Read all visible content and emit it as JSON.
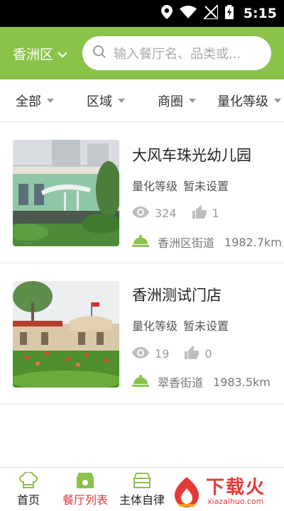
{
  "status_bar": {
    "time": "5:15"
  },
  "header": {
    "region": "香洲区",
    "search_placeholder": "输入餐厅名、品类或..."
  },
  "filters": [
    {
      "label": "全部"
    },
    {
      "label": "区域"
    },
    {
      "label": "商圈"
    },
    {
      "label": "量化等级"
    }
  ],
  "restaurants": [
    {
      "name": "大风车珠光幼儿园",
      "grade_label": "量化等级",
      "grade_value": "暂未设置",
      "views": "324",
      "likes": "1",
      "street": "香洲区街道",
      "distance": "1982.7km"
    },
    {
      "name": "香洲测试门店",
      "grade_label": "量化等级",
      "grade_value": "暂未设置",
      "views": "19",
      "likes": "0",
      "street": "翠香街道",
      "distance": "1983.5km"
    }
  ],
  "bottom_nav": [
    {
      "label": "首页",
      "active": false
    },
    {
      "label": "餐厅列表",
      "active": true
    },
    {
      "label": "主体自律",
      "active": false
    }
  ],
  "watermark": {
    "text": "下载火",
    "url": "xiazaihuo.com"
  },
  "colors": {
    "brand_green": "#8bc34a",
    "active_red": "#e53935"
  }
}
